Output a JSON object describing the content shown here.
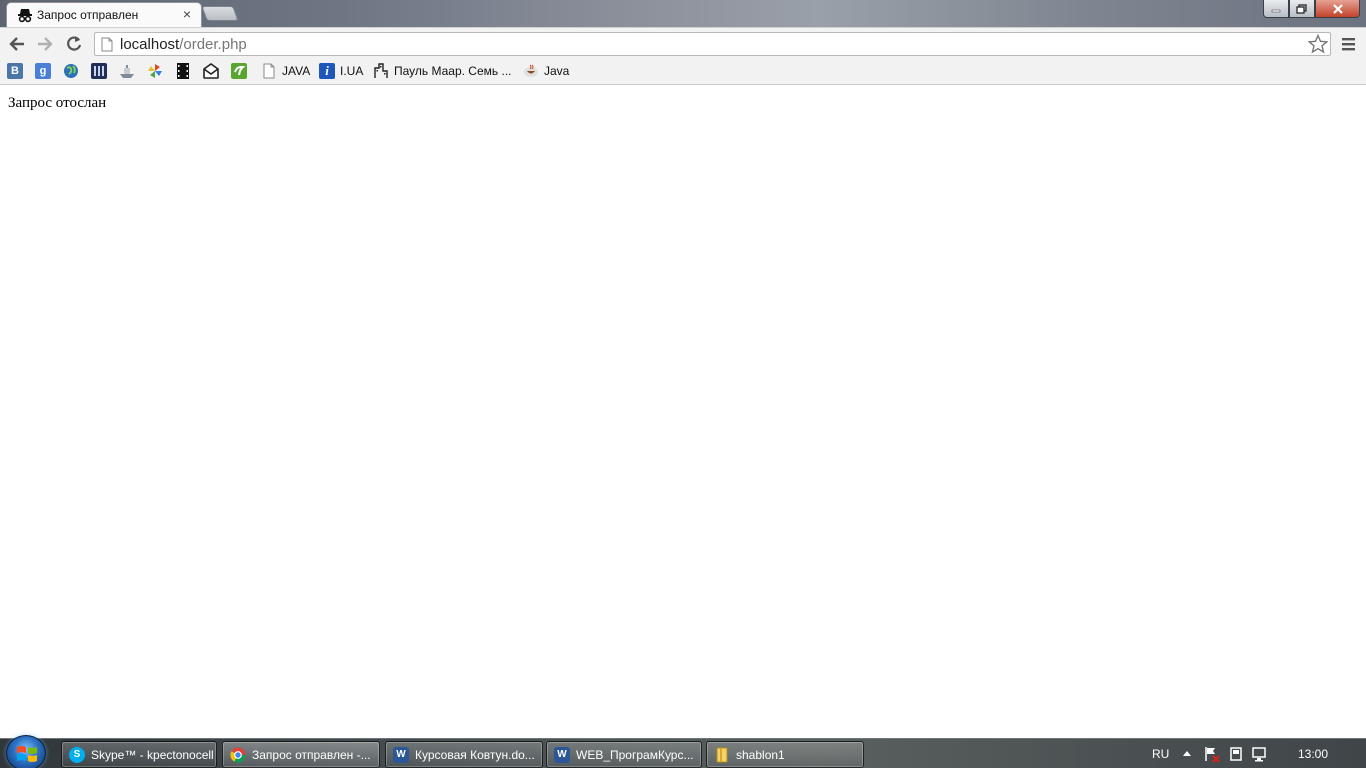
{
  "browser": {
    "active_tab": {
      "title": "Запрос отправлен",
      "close_glyph": "×"
    },
    "address": {
      "host": "localhost",
      "path": "/order.php"
    }
  },
  "bookmarks": [
    {
      "icon": "vk-icon",
      "glyph": "B",
      "color": "#4a76a8",
      "label": ""
    },
    {
      "icon": "google-icon",
      "glyph": "g",
      "color": "#4a7fd8",
      "label": ""
    },
    {
      "icon": "globe-icon",
      "glyph": "",
      "color": "#2d6fb8",
      "label": ""
    },
    {
      "icon": "library-icon",
      "glyph": "",
      "color": "#1f2f5a",
      "label": ""
    },
    {
      "icon": "ship-icon",
      "glyph": "",
      "color": "#9aa3ad",
      "label": ""
    },
    {
      "icon": "pinwheel-icon",
      "glyph": "",
      "color": "#d94a2a",
      "label": ""
    },
    {
      "icon": "film-icon",
      "glyph": "",
      "color": "#111111",
      "label": ""
    },
    {
      "icon": "mail-icon",
      "glyph": "",
      "color": "#222222",
      "label": ""
    },
    {
      "icon": "evernote-icon",
      "glyph": "",
      "color": "#5aa530",
      "label": ""
    },
    {
      "icon": "page-icon",
      "glyph": "",
      "color": "#ffffff",
      "label": "JAVA"
    },
    {
      "icon": "iua-icon",
      "glyph": "i",
      "color": "#1e57b8",
      "label": "I.UA"
    },
    {
      "icon": "building-icon",
      "glyph": "",
      "color": "#ffffff",
      "label": "Пауль Маар. Семь ..."
    },
    {
      "icon": "java-cup-icon",
      "glyph": "",
      "color": "#ffffff",
      "label": "Java"
    }
  ],
  "content": {
    "message": "Запрос отослан"
  },
  "taskbar": {
    "tasks": [
      {
        "icon": "skype-icon",
        "label": "Skype™ - kpectonocell",
        "color": "#00aff0"
      },
      {
        "icon": "chrome-icon",
        "label": "Запрос отправлен -...",
        "color": "#e0b030"
      },
      {
        "icon": "word-icon",
        "label": "Курсовая Ковтун.do...",
        "color": "#2b5797"
      },
      {
        "icon": "word-icon",
        "label": "WEB_ПрограмКурс...",
        "color": "#2b5797"
      },
      {
        "icon": "folder-icon",
        "label": "shablon1",
        "color": "#e8c04a"
      }
    ],
    "tray": {
      "language": "RU",
      "clock": "13:00"
    }
  }
}
